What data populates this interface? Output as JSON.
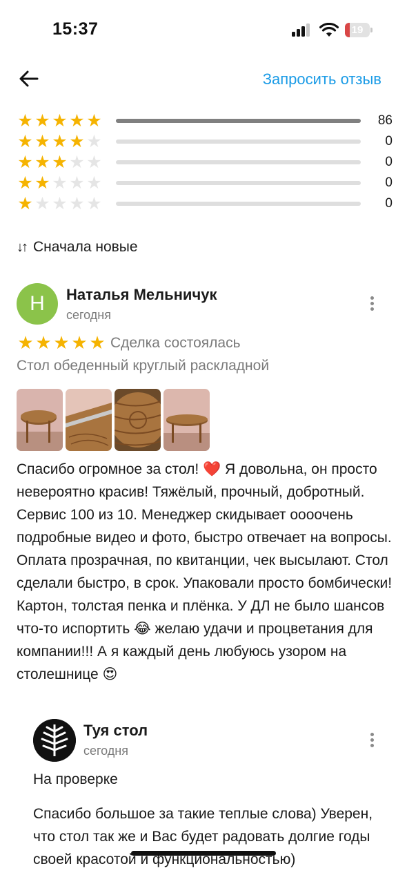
{
  "status_bar": {
    "time": "15:37",
    "battery_level": "19",
    "battery_fraction": 0.19,
    "icons": [
      "signal-icon",
      "wifi-icon",
      "battery-icon"
    ]
  },
  "header": {
    "back_icon": "arrow-left-icon",
    "request_review_label": "Запросить отзыв"
  },
  "rating_breakdown": [
    {
      "stars": 5,
      "count": "86",
      "fraction": 1.0
    },
    {
      "stars": 4,
      "count": "0",
      "fraction": 0
    },
    {
      "stars": 3,
      "count": "0",
      "fraction": 0
    },
    {
      "stars": 2,
      "count": "0",
      "fraction": 0
    },
    {
      "stars": 1,
      "count": "0",
      "fraction": 0
    }
  ],
  "sort": {
    "icon": "sort-icon",
    "label": "Сначала новые"
  },
  "review": {
    "avatar_letter": "Н",
    "author": "Наталья Мельничук",
    "date": "сегодня",
    "rating": 5,
    "deal_status": "Сделка состоялась",
    "product": "Стол обеденный круглый раскладной",
    "photo_count": 4,
    "text": "Спасибо огромное за стол! ❤️ Я довольна, он просто невероятно красив! Тяжёлый, прочный, добротный. Сервис 100 из 10. Менеджер скидывает оооочень подробные видео и фото, быстро отвечает на вопросы. Оплата прозрачная, по квитанции, чек высылают. Стол сделали быстро, в срок. Упаковали просто бомбически! Картон, толстая пенка и плёнка. У ДЛ не было шансов что-то испортить 😂 желаю удачи и процветания для компании!!! А я каждый день любуюсь узором на столешнице 😍"
  },
  "reply": {
    "author": "Туя стол",
    "date": "сегодня",
    "status": "На проверке",
    "text": "Спасибо большое за такие теплые слова) Уверен, что стол так же и Вас будет радовать долгие годы своей красотой и функциональностью)"
  },
  "colors": {
    "accent": "#1a9be6",
    "star": "#f5b301",
    "avatar_bg": "#8bc34a",
    "battery_low": "#d94646"
  }
}
